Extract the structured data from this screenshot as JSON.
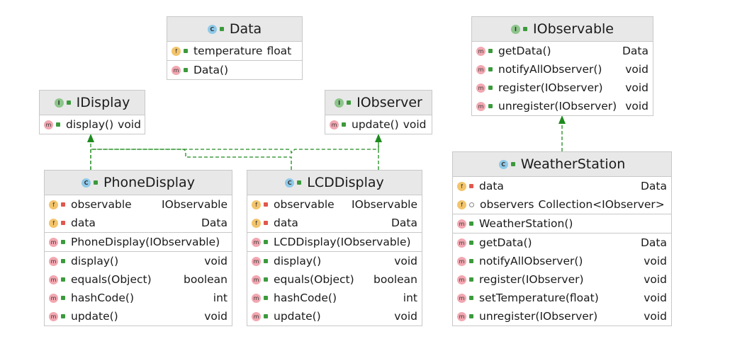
{
  "classes": {
    "data": {
      "name": "Data",
      "kind": "C",
      "fields": [
        {
          "icon": "f",
          "name": "temperature",
          "type": "float"
        }
      ],
      "constructors": [
        {
          "icon": "m",
          "name": "Data()",
          "type": ""
        }
      ]
    },
    "idisplay": {
      "name": "IDisplay",
      "kind": "I",
      "methods": [
        {
          "icon": "m",
          "name": "display()",
          "type": "void"
        }
      ]
    },
    "iobserver": {
      "name": "IObserver",
      "kind": "I",
      "methods": [
        {
          "icon": "m",
          "name": "update()",
          "type": "void"
        }
      ]
    },
    "iobservable": {
      "name": "IObservable",
      "kind": "I",
      "methods": [
        {
          "icon": "m",
          "name": "getData()",
          "type": "Data"
        },
        {
          "icon": "m",
          "name": "notifyAllObserver()",
          "type": "void"
        },
        {
          "icon": "m",
          "name": "register(IObserver)",
          "type": "void"
        },
        {
          "icon": "m",
          "name": "unregister(IObserver)",
          "type": "void"
        }
      ]
    },
    "phonedisplay": {
      "name": "PhoneDisplay",
      "kind": "C",
      "fields": [
        {
          "icon": "f",
          "name": "observable",
          "type": "IObservable"
        },
        {
          "icon": "f",
          "name": "data",
          "type": "Data"
        }
      ],
      "constructors": [
        {
          "icon": "m",
          "name": "PhoneDisplay(IObservable)",
          "type": ""
        }
      ],
      "methods": [
        {
          "icon": "m",
          "name": "display()",
          "type": "void"
        },
        {
          "icon": "m",
          "name": "equals(Object)",
          "type": "boolean"
        },
        {
          "icon": "m",
          "name": "hashCode()",
          "type": "int"
        },
        {
          "icon": "m",
          "name": "update()",
          "type": "void"
        }
      ]
    },
    "lcddisplay": {
      "name": "LCDDisplay",
      "kind": "C",
      "fields": [
        {
          "icon": "f",
          "name": "observable",
          "type": "IObservable"
        },
        {
          "icon": "f",
          "name": "data",
          "type": "Data"
        }
      ],
      "constructors": [
        {
          "icon": "m",
          "name": "LCDDisplay(IObservable)",
          "type": ""
        }
      ],
      "methods": [
        {
          "icon": "m",
          "name": "display()",
          "type": "void"
        },
        {
          "icon": "m",
          "name": "equals(Object)",
          "type": "boolean"
        },
        {
          "icon": "m",
          "name": "hashCode()",
          "type": "int"
        },
        {
          "icon": "m",
          "name": "update()",
          "type": "void"
        }
      ]
    },
    "weatherstation": {
      "name": "WeatherStation",
      "kind": "C",
      "fields": [
        {
          "icon": "f",
          "name": "data",
          "type": "Data"
        },
        {
          "icon": "f",
          "name": "observers",
          "type": "Collection<IObserver>"
        }
      ],
      "constructors": [
        {
          "icon": "m",
          "name": "WeatherStation()",
          "type": ""
        }
      ],
      "methods": [
        {
          "icon": "m",
          "name": "getData()",
          "type": "Data"
        },
        {
          "icon": "m",
          "name": "notifyAllObserver()",
          "type": "void"
        },
        {
          "icon": "m",
          "name": "register(IObserver)",
          "type": "void"
        },
        {
          "icon": "m",
          "name": "setTemperature(float)",
          "type": "void"
        },
        {
          "icon": "m",
          "name": "unregister(IObserver)",
          "type": "void"
        }
      ]
    }
  },
  "colors": {
    "edge": "#1e8a1e",
    "header": "#e8e8e8",
    "border": "#c8c8c8"
  }
}
